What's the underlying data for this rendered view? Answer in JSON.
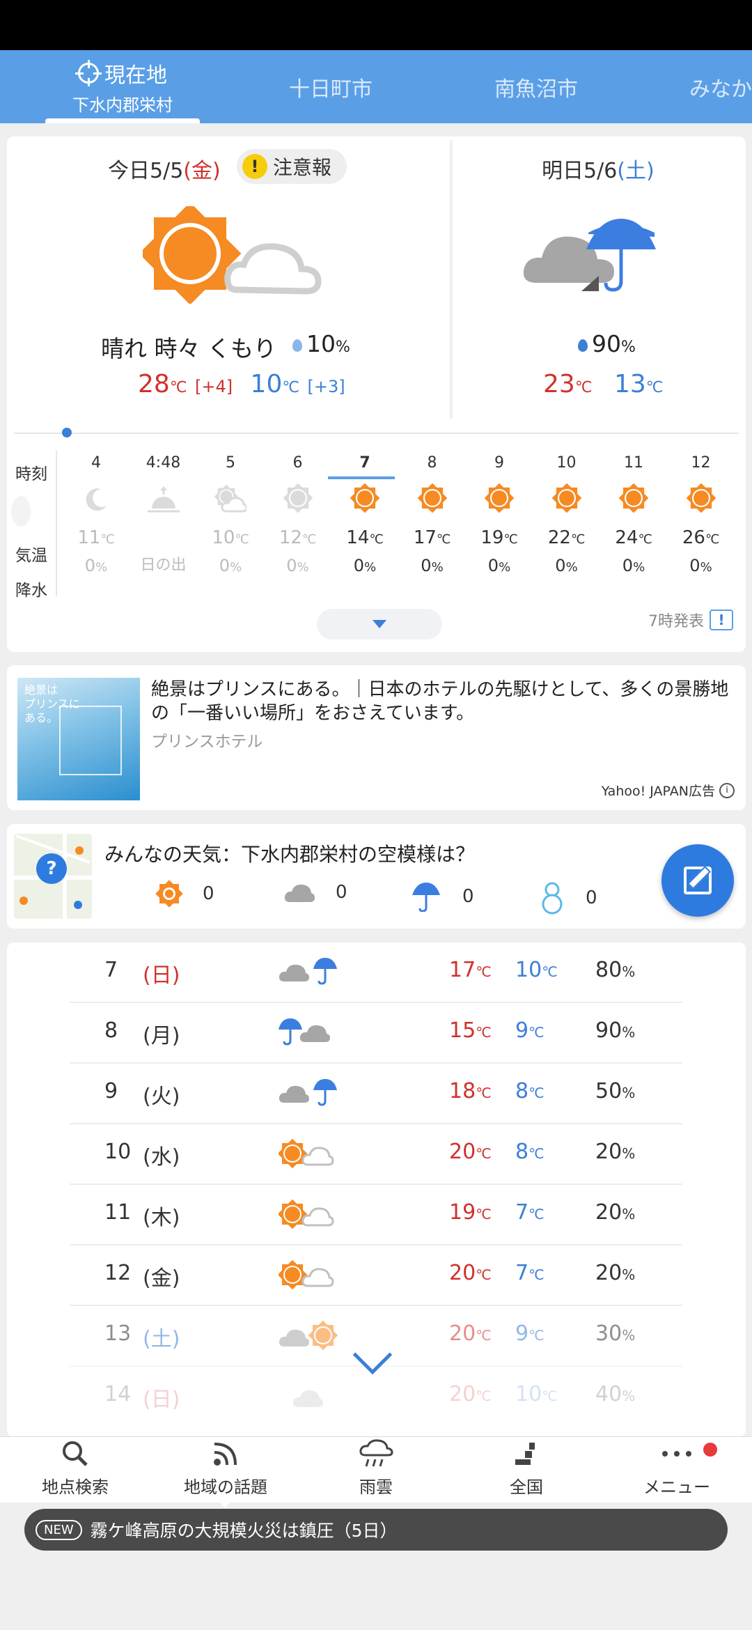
{
  "location_tabs": [
    {
      "label": "現在地",
      "sub": "下水内郡栄村",
      "active": true
    },
    {
      "label": "十日町市"
    },
    {
      "label": "南魚沼市"
    },
    {
      "label": "みなか"
    }
  ],
  "today": {
    "label": "今日5/5",
    "weekday": "(金)",
    "warning": "注意報",
    "condition": "晴れ 時々 くもり",
    "rain": "10",
    "high": "28",
    "high_diff": "[+4]",
    "low": "10",
    "low_diff": "[+3]",
    "unit": "℃",
    "pct": "%"
  },
  "tomorrow": {
    "label": "明日5/6",
    "weekday": "(土)",
    "rain": "90",
    "high": "23",
    "low": "13"
  },
  "hourly": {
    "labels": {
      "time": "時刻",
      "temp": "気温",
      "rain": "降水"
    },
    "hours": [
      {
        "h": "4",
        "icon": "moon-icon",
        "t": "11",
        "r": "0",
        "past": true
      },
      {
        "h": "4:48",
        "icon": "sunrise-icon",
        "t": "",
        "r": "日の出",
        "past": true,
        "special": true
      },
      {
        "h": "5",
        "icon": "sun-cloud-icon",
        "t": "10",
        "r": "0",
        "past": true
      },
      {
        "h": "6",
        "icon": "sun-icon",
        "t": "12",
        "r": "0",
        "past": true
      },
      {
        "h": "7",
        "icon": "sun-icon",
        "t": "14",
        "r": "0",
        "current": true
      },
      {
        "h": "8",
        "icon": "sun-icon",
        "t": "17",
        "r": "0"
      },
      {
        "h": "9",
        "icon": "sun-icon",
        "t": "19",
        "r": "0"
      },
      {
        "h": "10",
        "icon": "sun-icon",
        "t": "22",
        "r": "0"
      },
      {
        "h": "11",
        "icon": "sun-icon",
        "t": "24",
        "r": "0"
      },
      {
        "h": "12",
        "icon": "sun-icon",
        "t": "26",
        "r": "0"
      }
    ],
    "issued": "7時発表"
  },
  "ad": {
    "image_text": "絶景は\nプリンスに\nある。",
    "title": "絶景はプリンスにある。｜日本のホテルの先駆けとして、多くの景勝地の「一番いい場所」をおさえています。",
    "advertiser": "プリンスホテル",
    "footer": "Yahoo! JAPAN広告"
  },
  "community": {
    "title": "みんなの天気：下水内郡栄村の空模様は？",
    "counts": {
      "sunny": "0",
      "cloudy": "0",
      "rain": "0",
      "snow": "0"
    }
  },
  "weekly": [
    {
      "d": "7",
      "w": "(日)",
      "wc": "red",
      "icon": "cloud-rain-icon",
      "hi": "17",
      "lo": "10",
      "p": "80"
    },
    {
      "d": "8",
      "w": "(月)",
      "wc": "none",
      "icon": "rain-cloud-icon",
      "hi": "15",
      "lo": "9",
      "p": "90"
    },
    {
      "d": "9",
      "w": "(火)",
      "wc": "none",
      "icon": "cloud-rain-icon",
      "hi": "18",
      "lo": "8",
      "p": "50"
    },
    {
      "d": "10",
      "w": "(水)",
      "wc": "none",
      "icon": "sun-cloud-icon",
      "hi": "20",
      "lo": "8",
      "p": "20"
    },
    {
      "d": "11",
      "w": "(木)",
      "wc": "none",
      "icon": "sun-cloud-icon",
      "hi": "19",
      "lo": "7",
      "p": "20"
    },
    {
      "d": "12",
      "w": "(金)",
      "wc": "none",
      "icon": "sun-cloud-icon",
      "hi": "20",
      "lo": "7",
      "p": "20"
    },
    {
      "d": "13",
      "w": "(土)",
      "wc": "blue",
      "icon": "cloud-sun-icon",
      "hi": "20",
      "lo": "9",
      "p": "30"
    },
    {
      "d": "14",
      "w": "(日)",
      "wc": "red",
      "icon": "cloud-icon",
      "hi": "20",
      "lo": "10",
      "p": "40"
    }
  ],
  "nav": [
    {
      "label": "地点検索",
      "icon": "search-icon"
    },
    {
      "label": "地域の話題",
      "icon": "rss-icon"
    },
    {
      "label": "雨雲",
      "icon": "rain-cloud-icon"
    },
    {
      "label": "全国",
      "icon": "japan-icon"
    },
    {
      "label": "メニュー",
      "icon": "more-icon"
    }
  ],
  "news": {
    "tag": "NEW",
    "text": "霧ケ峰高原の大規模火災は鎮圧（5日）"
  },
  "colors": {
    "header": "#5a9fe6",
    "high": "#d0312d",
    "low": "#3b7fd6",
    "sun": "#f68a23",
    "accent": "#2e7be0"
  }
}
